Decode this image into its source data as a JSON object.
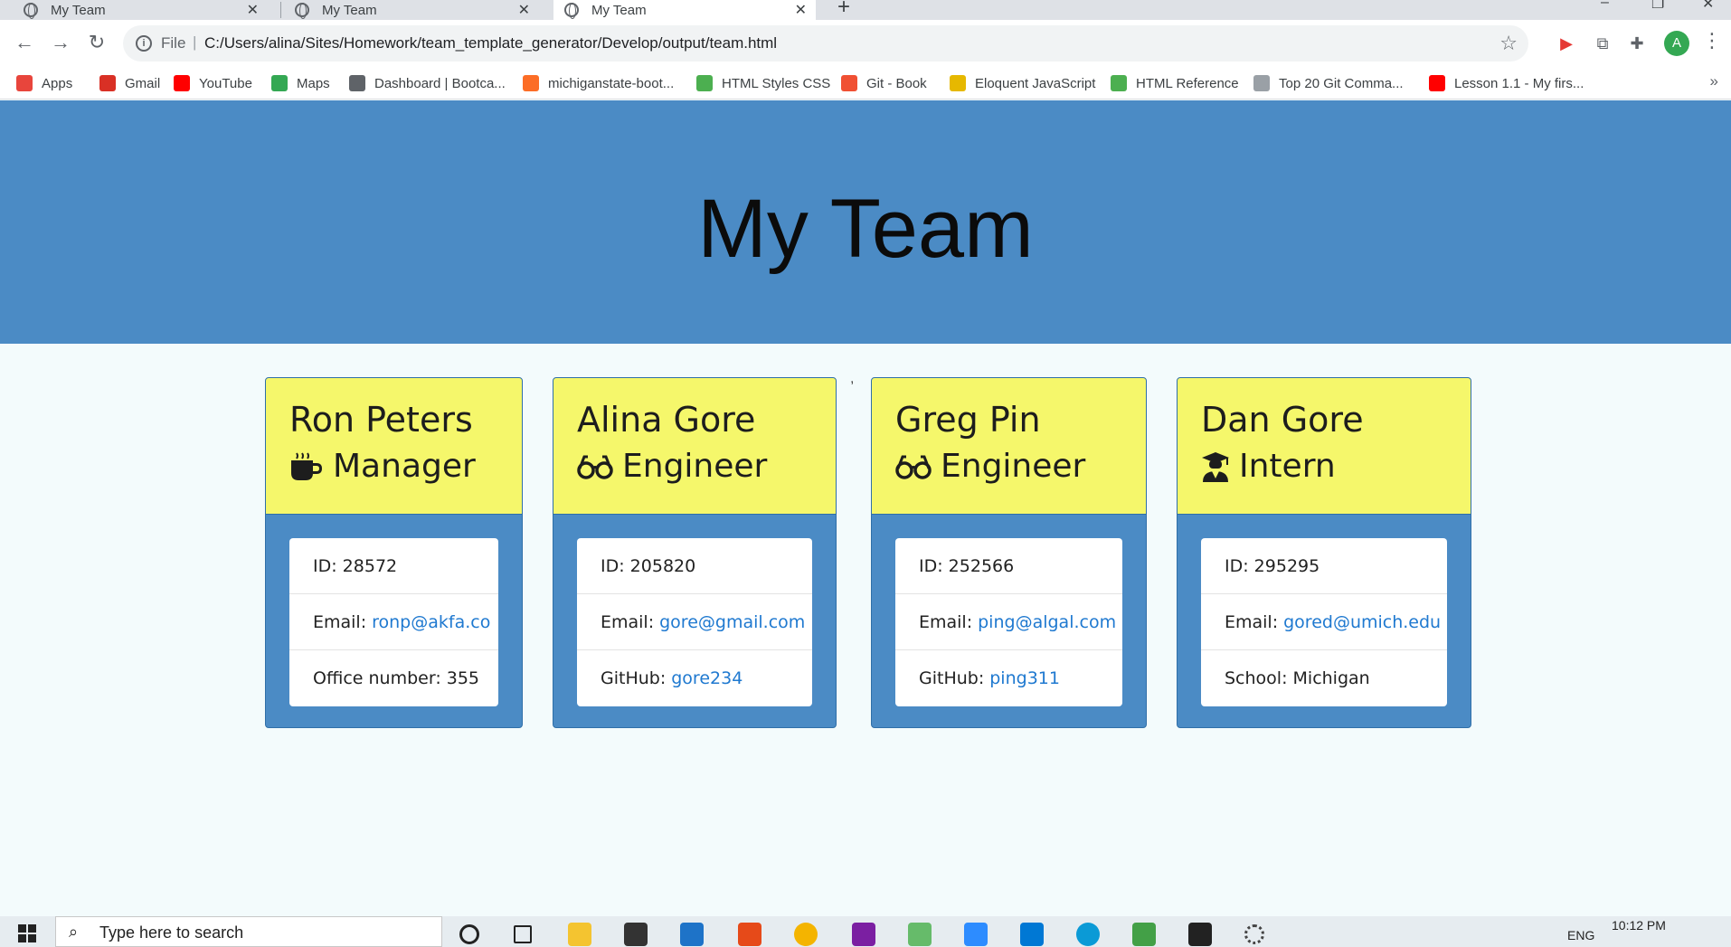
{
  "browser": {
    "tabs": [
      {
        "title": "My Team",
        "active": false
      },
      {
        "title": "My Team",
        "active": false
      },
      {
        "title": "My Team",
        "active": true
      }
    ],
    "address": {
      "scheme": "File",
      "url": "C:/Users/alina/Sites/Homework/team_template_generator/Develop/output/team.html"
    },
    "profile_initial": "A",
    "bookmarks": [
      {
        "label": "Apps",
        "color": "#e8453c"
      },
      {
        "label": "Gmail",
        "color": "#d93025"
      },
      {
        "label": "YouTube",
        "color": "#ff0000"
      },
      {
        "label": "Maps",
        "color": "#34a853"
      },
      {
        "label": "Dashboard | Bootca...",
        "color": "#5f6368"
      },
      {
        "label": "michiganstate-boot...",
        "color": "#fc6d26"
      },
      {
        "label": "HTML Styles CSS",
        "color": "#4caf50"
      },
      {
        "label": "Git - Book",
        "color": "#f05033"
      },
      {
        "label": "Eloquent JavaScript",
        "color": "#e6b800"
      },
      {
        "label": "HTML Reference",
        "color": "#4caf50"
      },
      {
        "label": "Top 20 Git Comma...",
        "color": "#9aa0a6"
      },
      {
        "label": "Lesson 1.1 - My firs...",
        "color": "#ff0000"
      }
    ]
  },
  "page": {
    "title": "My Team",
    "stray_mark": ",",
    "cards": [
      {
        "name": "Ron Peters",
        "role": "Manager",
        "icon": "coffee-icon",
        "id": "ID: 28572",
        "email_label": "Email:",
        "email": "ronp@akfa.co",
        "extra_label": "Office number: 355",
        "extra_link": ""
      },
      {
        "name": "Alina Gore",
        "role": "Engineer",
        "icon": "glasses-icon",
        "id": "ID: 205820",
        "email_label": "Email:",
        "email": "gore@gmail.com",
        "extra_label": "GitHub:",
        "extra_link": "gore234"
      },
      {
        "name": "Greg Pin",
        "role": "Engineer",
        "icon": "glasses-icon",
        "id": "ID: 252566",
        "email_label": "Email:",
        "email": "ping@algal.com",
        "extra_label": "GitHub:",
        "extra_link": "ping311"
      },
      {
        "name": "Dan Gore",
        "role": "Intern",
        "icon": "graduate-icon",
        "id": "ID: 295295",
        "email_label": "Email:",
        "email": "gored@umich.edu",
        "extra_label": "School: Michigan",
        "extra_link": ""
      }
    ]
  },
  "colors": {
    "jumbotron": "#4b8bc5",
    "card_header": "#f5f76b",
    "link": "#1f79d0"
  },
  "taskbar": {
    "search_placeholder": "Type here to search",
    "time": "10:12 PM",
    "language": "ENG"
  }
}
